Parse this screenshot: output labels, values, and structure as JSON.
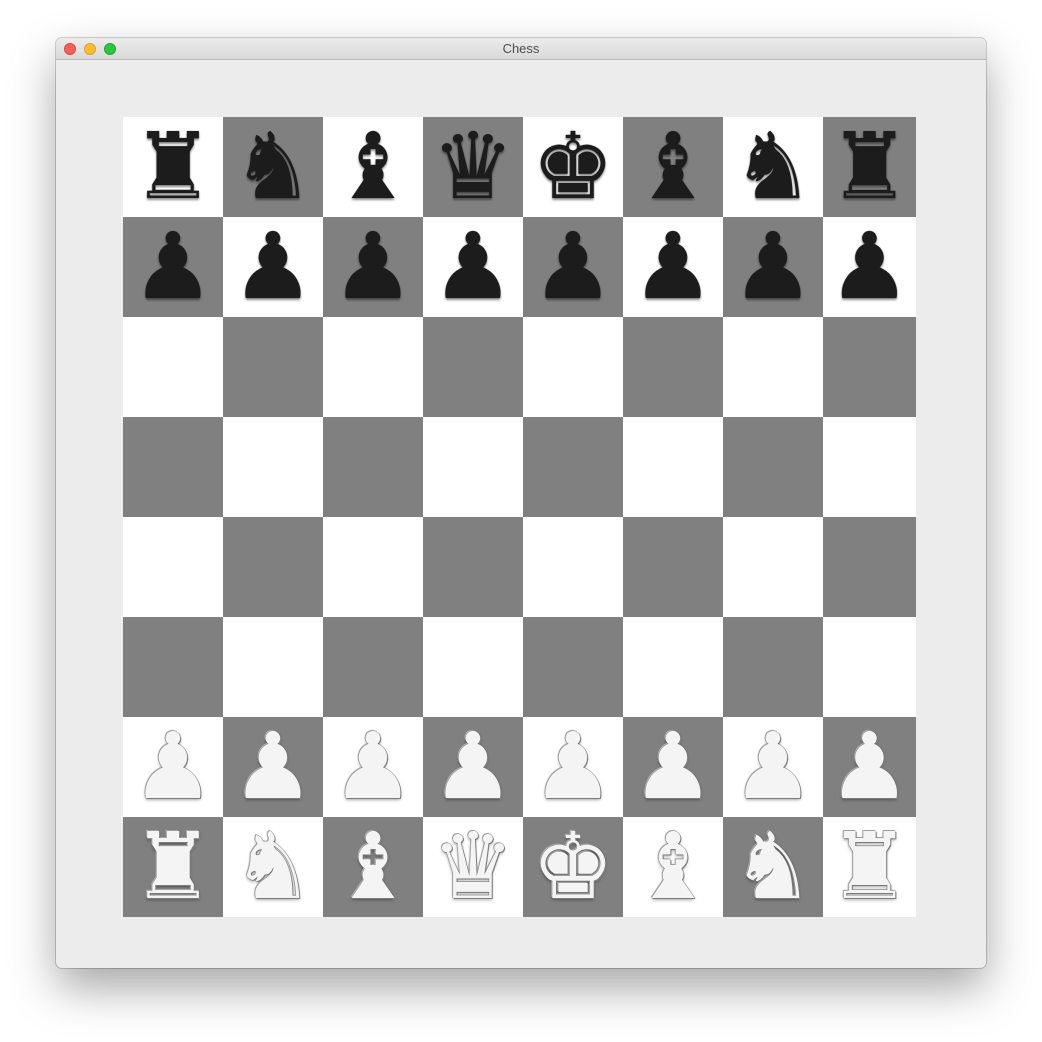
{
  "window": {
    "title": "Chess"
  },
  "board": {
    "colors": {
      "light_square": "#ffffff",
      "dark_square": "#808080",
      "black_piece": "#1c1c1c",
      "white_piece": "#f4f4f4"
    },
    "top_left_square": "light",
    "ranks": [
      [
        {
          "piece": "rook",
          "color": "black",
          "glyph": "♜"
        },
        {
          "piece": "knight",
          "color": "black",
          "glyph": "♞"
        },
        {
          "piece": "bishop",
          "color": "black",
          "glyph": "♝"
        },
        {
          "piece": "queen",
          "color": "black",
          "glyph": "♛"
        },
        {
          "piece": "king",
          "color": "black",
          "glyph": "♚"
        },
        {
          "piece": "bishop",
          "color": "black",
          "glyph": "♝"
        },
        {
          "piece": "knight",
          "color": "black",
          "glyph": "♞"
        },
        {
          "piece": "rook",
          "color": "black",
          "glyph": "♜"
        }
      ],
      [
        {
          "piece": "pawn",
          "color": "black",
          "glyph": "♟"
        },
        {
          "piece": "pawn",
          "color": "black",
          "glyph": "♟"
        },
        {
          "piece": "pawn",
          "color": "black",
          "glyph": "♟"
        },
        {
          "piece": "pawn",
          "color": "black",
          "glyph": "♟"
        },
        {
          "piece": "pawn",
          "color": "black",
          "glyph": "♟"
        },
        {
          "piece": "pawn",
          "color": "black",
          "glyph": "♟"
        },
        {
          "piece": "pawn",
          "color": "black",
          "glyph": "♟"
        },
        {
          "piece": "pawn",
          "color": "black",
          "glyph": "♟"
        }
      ],
      [
        null,
        null,
        null,
        null,
        null,
        null,
        null,
        null
      ],
      [
        null,
        null,
        null,
        null,
        null,
        null,
        null,
        null
      ],
      [
        null,
        null,
        null,
        null,
        null,
        null,
        null,
        null
      ],
      [
        null,
        null,
        null,
        null,
        null,
        null,
        null,
        null
      ],
      [
        {
          "piece": "pawn",
          "color": "white",
          "glyph": "♟"
        },
        {
          "piece": "pawn",
          "color": "white",
          "glyph": "♟"
        },
        {
          "piece": "pawn",
          "color": "white",
          "glyph": "♟"
        },
        {
          "piece": "pawn",
          "color": "white",
          "glyph": "♟"
        },
        {
          "piece": "pawn",
          "color": "white",
          "glyph": "♟"
        },
        {
          "piece": "pawn",
          "color": "white",
          "glyph": "♟"
        },
        {
          "piece": "pawn",
          "color": "white",
          "glyph": "♟"
        },
        {
          "piece": "pawn",
          "color": "white",
          "glyph": "♟"
        }
      ],
      [
        {
          "piece": "rook",
          "color": "white",
          "glyph": "♜"
        },
        {
          "piece": "knight",
          "color": "white",
          "glyph": "♞"
        },
        {
          "piece": "bishop",
          "color": "white",
          "glyph": "♝"
        },
        {
          "piece": "queen",
          "color": "white",
          "glyph": "♛"
        },
        {
          "piece": "king",
          "color": "white",
          "glyph": "♚"
        },
        {
          "piece": "bishop",
          "color": "white",
          "glyph": "♝"
        },
        {
          "piece": "knight",
          "color": "white",
          "glyph": "♞"
        },
        {
          "piece": "rook",
          "color": "white",
          "glyph": "♜"
        }
      ]
    ]
  }
}
